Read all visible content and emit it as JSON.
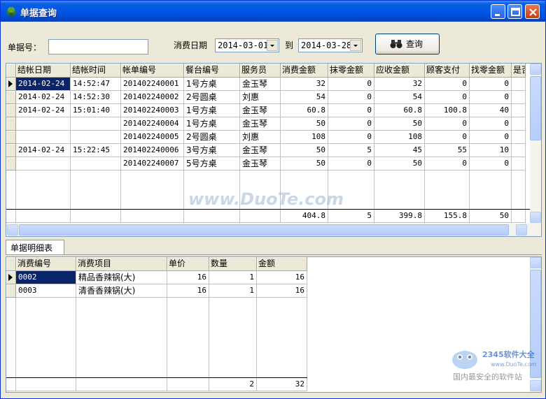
{
  "window": {
    "title": "单据查询"
  },
  "filters": {
    "bill_no_label": "单据号：",
    "bill_no_value": "",
    "date_label": "消费日期",
    "date_from": "2014-03-01",
    "to_label": "到",
    "date_to": "2014-03-28",
    "query_label": "查询"
  },
  "master": {
    "columns": [
      "结帐日期",
      "结帐时间",
      "帐单编号",
      "餐台编号",
      "服务员",
      "消费金额",
      "抹零金额",
      "应收金额",
      "顾客支付",
      "找零金额",
      "是否"
    ],
    "rows": [
      [
        "2014-02-24",
        "14:52:47",
        "201402240001",
        "1号方桌",
        "金玉琴",
        "32",
        "0",
        "32",
        "0",
        "0"
      ],
      [
        "2014-02-24",
        "14:52:30",
        "201402240002",
        "2号圆桌",
        "刘惠",
        "54",
        "0",
        "54",
        "0",
        "0"
      ],
      [
        "2014-02-24",
        "15:01:40",
        "201402240003",
        "1号方桌",
        "金玉琴",
        "60.8",
        "0",
        "60.8",
        "100.8",
        "40"
      ],
      [
        "",
        "",
        "201402240004",
        "1号方桌",
        "金玉琴",
        "50",
        "0",
        "50",
        "0",
        "0"
      ],
      [
        "",
        "",
        "201402240005",
        "2号圆桌",
        "刘惠",
        "108",
        "0",
        "108",
        "0",
        "0"
      ],
      [
        "2014-02-24",
        "15:22:45",
        "201402240006",
        "3号方桌",
        "金玉琴",
        "50",
        "5",
        "45",
        "55",
        "10"
      ],
      [
        "",
        "",
        "201402240007",
        "5号方桌",
        "金玉琴",
        "50",
        "0",
        "50",
        "0",
        "0"
      ]
    ],
    "totals": [
      "",
      "",
      "",
      "",
      "",
      "404.8",
      "5",
      "399.8",
      "155.8",
      "50"
    ]
  },
  "detail": {
    "tab_label": "单据明细表",
    "columns": [
      "消费编号",
      "消费项目",
      "单价",
      "数量",
      "金额"
    ],
    "rows": [
      [
        "0002",
        "精品香辣锅(大)",
        "16",
        "1",
        "16"
      ],
      [
        "0003",
        "清香香辣锅(大)",
        "16",
        "1",
        "16"
      ]
    ],
    "totals": [
      "",
      "",
      "",
      "2",
      "32"
    ]
  },
  "watermarks": {
    "center": "www.DuoTe.com",
    "corner_brand": "2345软件大全",
    "corner_url": "www.DuoTe.com",
    "corner_tagline": "国内最安全的软件站"
  },
  "colors": {
    "titlebar": "#0058e6",
    "selection": "#0a246a",
    "face": "#ece9d8"
  }
}
